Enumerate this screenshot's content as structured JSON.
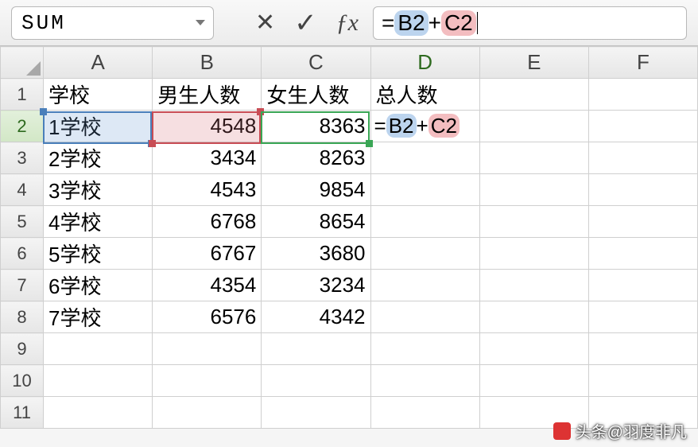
{
  "formula_bar": {
    "name_box": "SUM",
    "formula_raw": "=B2+C2",
    "ref1": "B2",
    "ref2": "C2"
  },
  "columns": [
    "A",
    "B",
    "C",
    "D",
    "E",
    "F"
  ],
  "rows": [
    "1",
    "2",
    "3",
    "4",
    "5",
    "6",
    "7",
    "8",
    "9",
    "10",
    "11"
  ],
  "headers": {
    "A": "学校",
    "B": "男生人数",
    "C": "女生人数",
    "D": "总人数"
  },
  "data": [
    {
      "A": "1学校",
      "B": "4548",
      "C": "8363"
    },
    {
      "A": "2学校",
      "B": "3434",
      "C": "8263"
    },
    {
      "A": "3学校",
      "B": "4543",
      "C": "9854"
    },
    {
      "A": "4学校",
      "B": "6768",
      "C": "8654"
    },
    {
      "A": "5学校",
      "B": "6767",
      "C": "3680"
    },
    {
      "A": "6学校",
      "B": "4354",
      "C": "3234"
    },
    {
      "A": "7学校",
      "B": "6576",
      "C": "4342"
    }
  ],
  "editing_cell": {
    "address": "D2",
    "display_prefix": "=",
    "ref1": "B2",
    "plus": "+",
    "ref2": "C2"
  },
  "watermark": "头条@羽度非凡"
}
